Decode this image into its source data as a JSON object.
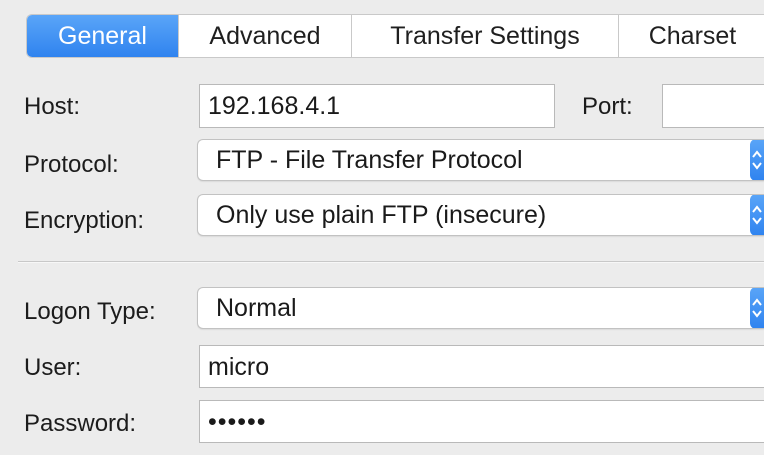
{
  "tabs": [
    {
      "label": "General",
      "active": true
    },
    {
      "label": "Advanced",
      "active": false
    },
    {
      "label": "Transfer Settings",
      "active": false
    },
    {
      "label": "Charset",
      "active": false
    }
  ],
  "form": {
    "host_label": "Host:",
    "host_value": "192.168.4.1",
    "port_label": "Port:",
    "port_value": "",
    "protocol_label": "Protocol:",
    "protocol_value": "FTP - File Transfer Protocol",
    "encryption_label": "Encryption:",
    "encryption_value": "Only use plain FTP (insecure)",
    "logon_type_label": "Logon Type:",
    "logon_type_value": "Normal",
    "user_label": "User:",
    "user_value": "micro",
    "password_label": "Password:",
    "password_value": "••••••"
  },
  "colors": {
    "accent": "#3b8ff2",
    "background": "#ececec"
  },
  "icons": {
    "select_arrows": "chevron-up-down-icon"
  }
}
